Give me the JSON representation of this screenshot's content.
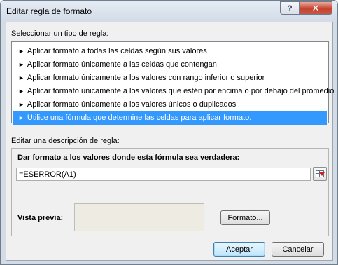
{
  "window": {
    "title": "Editar regla de formato",
    "help_label": "?",
    "close_label": "✕"
  },
  "rule_type": {
    "label": "Seleccionar un tipo de regla:",
    "items": [
      "Aplicar formato a todas las celdas según sus valores",
      "Aplicar formato únicamente a las celdas que contengan",
      "Aplicar formato únicamente a los valores con rango inferior o superior",
      "Aplicar formato únicamente a los valores que estén por encima o por debajo del promedio",
      "Aplicar formato únicamente a los valores únicos o duplicados",
      "Utilice una fórmula que determine las celdas para aplicar formato."
    ],
    "selected_index": 5
  },
  "description": {
    "label": "Editar una descripción de regla:",
    "formula_heading": "Dar formato a los valores donde esta fórmula sea verdadera:",
    "formula_value": "=ESERROR(A1)",
    "preview_label": "Vista previa:",
    "preview_color": "#eeece2",
    "format_button": "Formato..."
  },
  "buttons": {
    "accept": "Aceptar",
    "cancel": "Cancelar"
  },
  "colors": {
    "selection": "#3399ff",
    "title_gradient_top": "#e5ecf4",
    "close_red": "#c8432e"
  }
}
